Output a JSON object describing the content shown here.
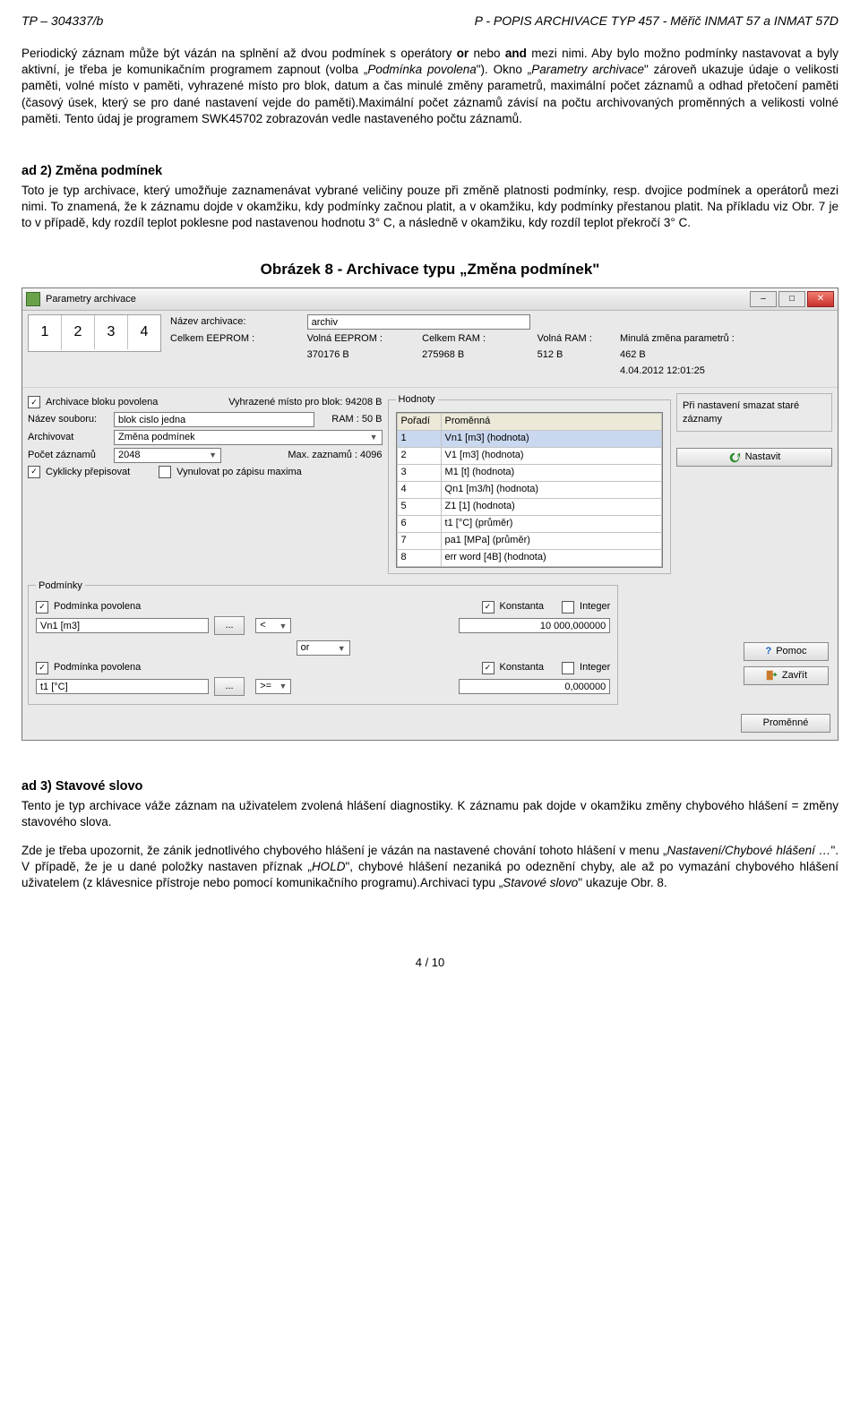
{
  "meta": {
    "doc_id": "TP – 304337/b",
    "doc_title": "P - POPIS ARCHIVACE   TYP 457 - Měřič INMAT 57 a INMAT 57D",
    "page": "4 / 10"
  },
  "p1a": "Periodický záznam může být vázán na splnění až dvou podmínek s operátory ",
  "p1_or": "or",
  "p1b": " nebo ",
  "p1_and": "and",
  "p1c": " mezi nimi. Aby bylo možno podmínky nastavovat a byly aktivní, je třeba je komunikačním programem zapnout (volba „",
  "p1_it1": "Podmínka povolena",
  "p1d": "\"). Okno „",
  "p1_it2": "Parametry archivace",
  "p1e": "\" zároveň ukazuje údaje o velikosti paměti, volné místo v paměti, vyhrazené místo pro blok, datum a čas minulé změny parametrů, maximální počet záznamů a odhad přetočení paměti (časový úsek, který se pro dané nastavení vejde do paměti).Maximální počet záznamů závisí na počtu archivovaných proměnných a velikosti volné paměti. Tento údaj je programem SWK45702 zobrazován vedle nastaveného počtu záznamů.",
  "h2": "ad 2) Změna podmínek",
  "p2": "Toto je typ archivace, který umožňuje zaznamenávat vybrané veličiny pouze při změně platnosti podmínky, resp. dvojice podmínek a operátorů mezi nimi. To znamená, že k záznamu dojde v okamžiku, kdy podmínky začnou platit, a v okamžiku, kdy podmínky přestanou platit. Na příkladu viz Obr. 7 je to v případě, kdy rozdíl teplot poklesne pod nastavenou hodnotu 3° C, a následně v okamžiku, kdy rozdíl teplot překročí 3° C.",
  "figcap": "Obrázek 8 - Archivace typu „Změna podmínek\"",
  "win": {
    "title": "Parametry archivace",
    "name_lbl": "Název archivace:",
    "name_val": "archiv",
    "tabs": [
      "1",
      "2",
      "3",
      "4"
    ],
    "stats": {
      "l1": "Celkem EEPROM :",
      "v1": "370176 B",
      "l2": "Volná EEPROM :",
      "v2": "275968 B",
      "l3": "Celkem RAM :",
      "v3": "512 B",
      "l4": "Volná RAM :",
      "v4": "462 B",
      "l5": "Minulá změna parametrů :",
      "v5": "4.04.2012  12:01:25"
    },
    "left": {
      "chk_arch": "Archivace bloku povolena",
      "alloc": "Vyhrazené místo pro blok: 94208 B",
      "lbl_nazev": "Název souboru:",
      "val_nazev": "blok cislo jedna",
      "lbl_ram": "RAM : 50 B",
      "lbl_archivovat": "Archivovat",
      "val_archivovat": "Změna podmínek",
      "lbl_pocet": "Počet záznamů",
      "val_pocet": "2048",
      "lbl_max": "Max. zaznamů : 4096",
      "chk_cyc": "Cyklicky přepisovat",
      "chk_zero": "Vynulovat po zápisu maxima"
    },
    "hodnoty": {
      "legend": "Hodnoty",
      "cols": [
        "Pořadí",
        "Proměnná"
      ],
      "rows": [
        [
          "1",
          "Vn1  [m3] (hodnota)"
        ],
        [
          "2",
          "V1  [m3] (hodnota)"
        ],
        [
          "3",
          "M1  [t] (hodnota)"
        ],
        [
          "4",
          "Qn1  [m3/h] (hodnota)"
        ],
        [
          "5",
          "Z1  [1] (hodnota)"
        ],
        [
          "6",
          "t1  [°C] (průměr)"
        ],
        [
          "7",
          "pa1  [MPa] (průměr)"
        ],
        [
          "8",
          "err word [4B] (hodnota)"
        ]
      ]
    },
    "side": {
      "note": "Při nastavení smazat staré záznamy",
      "btn_set": "Nastavit",
      "btn_help": "Pomoc",
      "btn_close": "Zavřít"
    },
    "cond": {
      "legend": "Podmínky",
      "chk_en": "Podmínka povolena",
      "chk_k": "Konstanta",
      "chk_i": "Integer",
      "r1var": "Vn1  [m3]",
      "r1op": "<",
      "r1val": "10 000,000000",
      "opcombo": "or",
      "r2var": "t1  [°C]",
      "r2op": ">=",
      "r2val": "0,000000",
      "dots": "..."
    },
    "btn_vars": "Proměnné"
  },
  "h3": "ad 3) Stavové slovo",
  "p3a": "Tento je typ archivace váže záznam na uživatelem zvolená hlášení diagnostiky. K záznamu pak dojde v okamžiku změny chybového hlášení = změny stavového slova.",
  "p3b_a": "Zde je třeba upozornit, že zánik jednotlivého chybového hlášení je vázán na nastavené chování tohoto hlášení v menu „",
  "p3b_it1": "Nastavení/Chybové hlášení …",
  "p3b_b": "\". V případě, že je u dané položky nastaven příznak „",
  "p3b_it2": "HOLD",
  "p3b_c": "\", chybové hlášení nezaniká po odeznění chyby, ale až po vymazání chybového hlášení uživatelem (z klávesnice přístroje nebo pomocí komunikačního programu).Archivaci typu „",
  "p3b_it3": "Stavové slovo",
  "p3b_d": "\" ukazuje Obr. 8."
}
